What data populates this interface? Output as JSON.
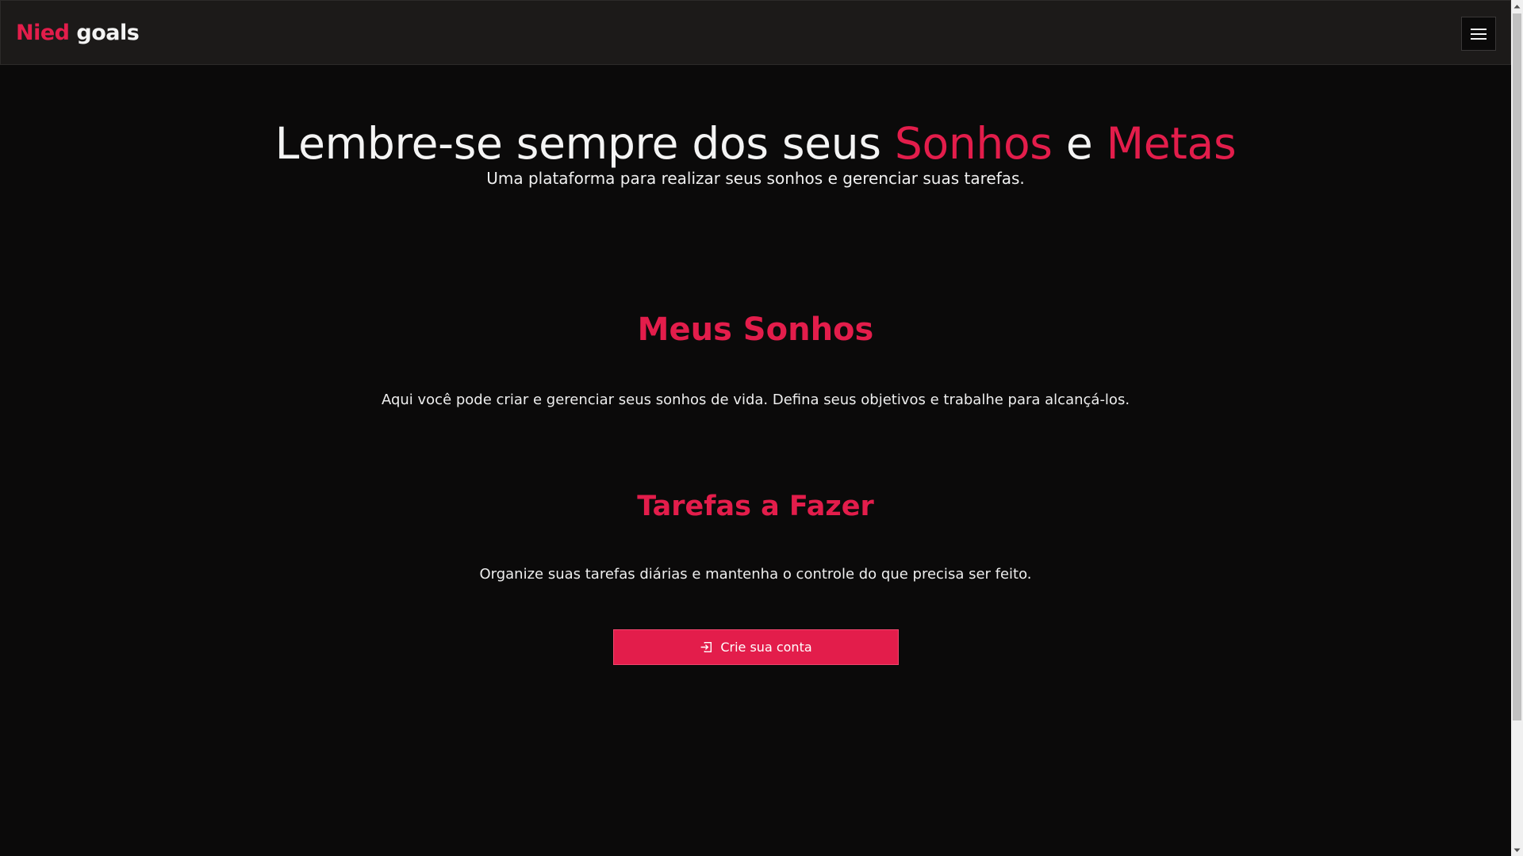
{
  "navbar": {
    "brand_accent": "Nied",
    "brand_rest": "goals",
    "menu_icon": "hamburger-icon"
  },
  "hero": {
    "title_part1": "Lembre-se sempre dos seus ",
    "title_accent1": "Sonhos",
    "title_part2": " e ",
    "title_accent2": "Metas",
    "subtitle": "Uma plataforma para realizar seus sonhos e gerenciar suas tarefas."
  },
  "sections": [
    {
      "title": "Meus Sonhos",
      "text": "Aqui você pode criar e gerenciar seus sonhos de vida. Defina seus objetivos e trabalhe para alcançá-los."
    },
    {
      "title": "Tarefas a Fazer",
      "text": "Organize suas tarefas diárias e mantenha o controle do que precisa ser feito."
    }
  ],
  "cta": {
    "label": "Crie sua conta",
    "icon": "sign-in-icon"
  },
  "colors": {
    "accent": "#e31d4b",
    "background": "#0b0a0a",
    "navbar": "#1c1a19"
  }
}
